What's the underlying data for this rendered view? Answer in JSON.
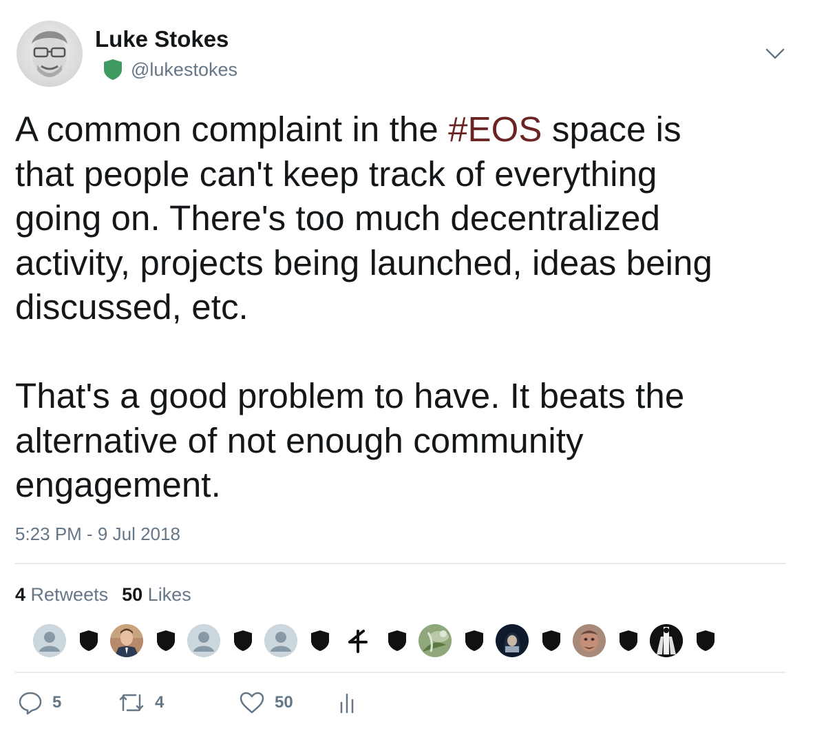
{
  "author": {
    "name": "Luke Stokes",
    "handle": "@lukestokes",
    "verified_badge_color": "#3f9a5f"
  },
  "tweet": {
    "text_before_hashtag": "A common complaint in the ",
    "hashtag": "#EOS",
    "text_after_hashtag": " space is\nthat people can't keep track of everything\ngoing on. There's too much decentralized\nactivity, projects being launched, ideas being\ndiscussed, etc.\n\nThat's a good problem to have. It beats the\nalternative of not enough community\nengagement.",
    "timestamp": "5:23 PM - 9 Jul 2018"
  },
  "stats": {
    "retweets_count": "4",
    "retweets_label": "Retweets",
    "likes_count": "50",
    "likes_label": "Likes"
  },
  "likers": [
    {
      "type": "default-avatar"
    },
    {
      "type": "photo-suit"
    },
    {
      "type": "default-avatar"
    },
    {
      "type": "default-avatar"
    },
    {
      "type": "glyph",
      "glyph": "∢"
    },
    {
      "type": "photo-plant"
    },
    {
      "type": "photo-dark"
    },
    {
      "type": "photo-face"
    },
    {
      "type": "photo-bw"
    }
  ],
  "actions": {
    "reply_count": "5",
    "retweet_count": "4",
    "like_count": "50"
  },
  "colors": {
    "hashtag": "#6b2424",
    "secondary_text": "#657786",
    "divider": "#e6ecf0"
  }
}
